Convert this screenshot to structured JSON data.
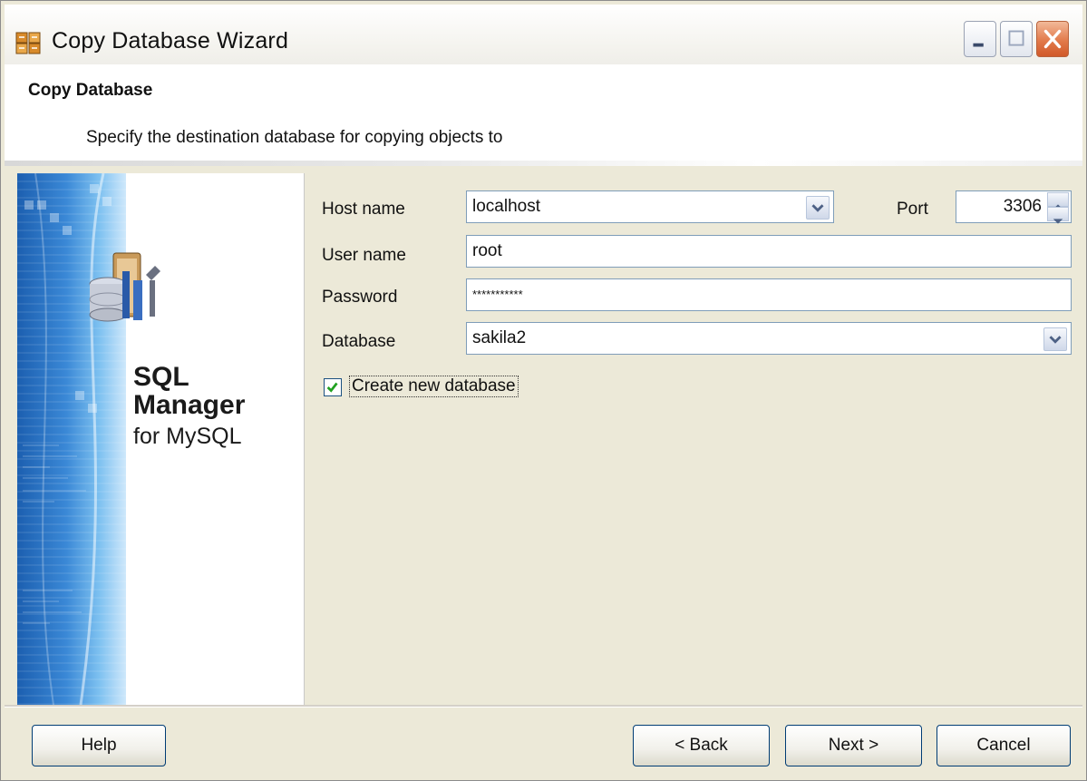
{
  "window": {
    "title": "Copy Database Wizard"
  },
  "header": {
    "title": "Copy Database",
    "description": "Specify the destination database for copying objects to"
  },
  "banner": {
    "line1": "SQL",
    "line2": "Manager",
    "line3": "for MySQL"
  },
  "form": {
    "host_label": "Host name",
    "host_value": "localhost",
    "port_label": "Port",
    "port_value": "3306",
    "user_label": "User name",
    "user_value": "root",
    "password_label": "Password",
    "password_value": "***********",
    "database_label": "Database",
    "database_value": "sakila2",
    "create_new_label": "Create new database",
    "create_new_checked": true
  },
  "buttons": {
    "help": "Help",
    "back": "< Back",
    "next": "Next >",
    "cancel": "Cancel"
  },
  "colors": {
    "field_border": "#7f9db9",
    "button_border": "#003c74",
    "close_button": "#e27a4a"
  }
}
